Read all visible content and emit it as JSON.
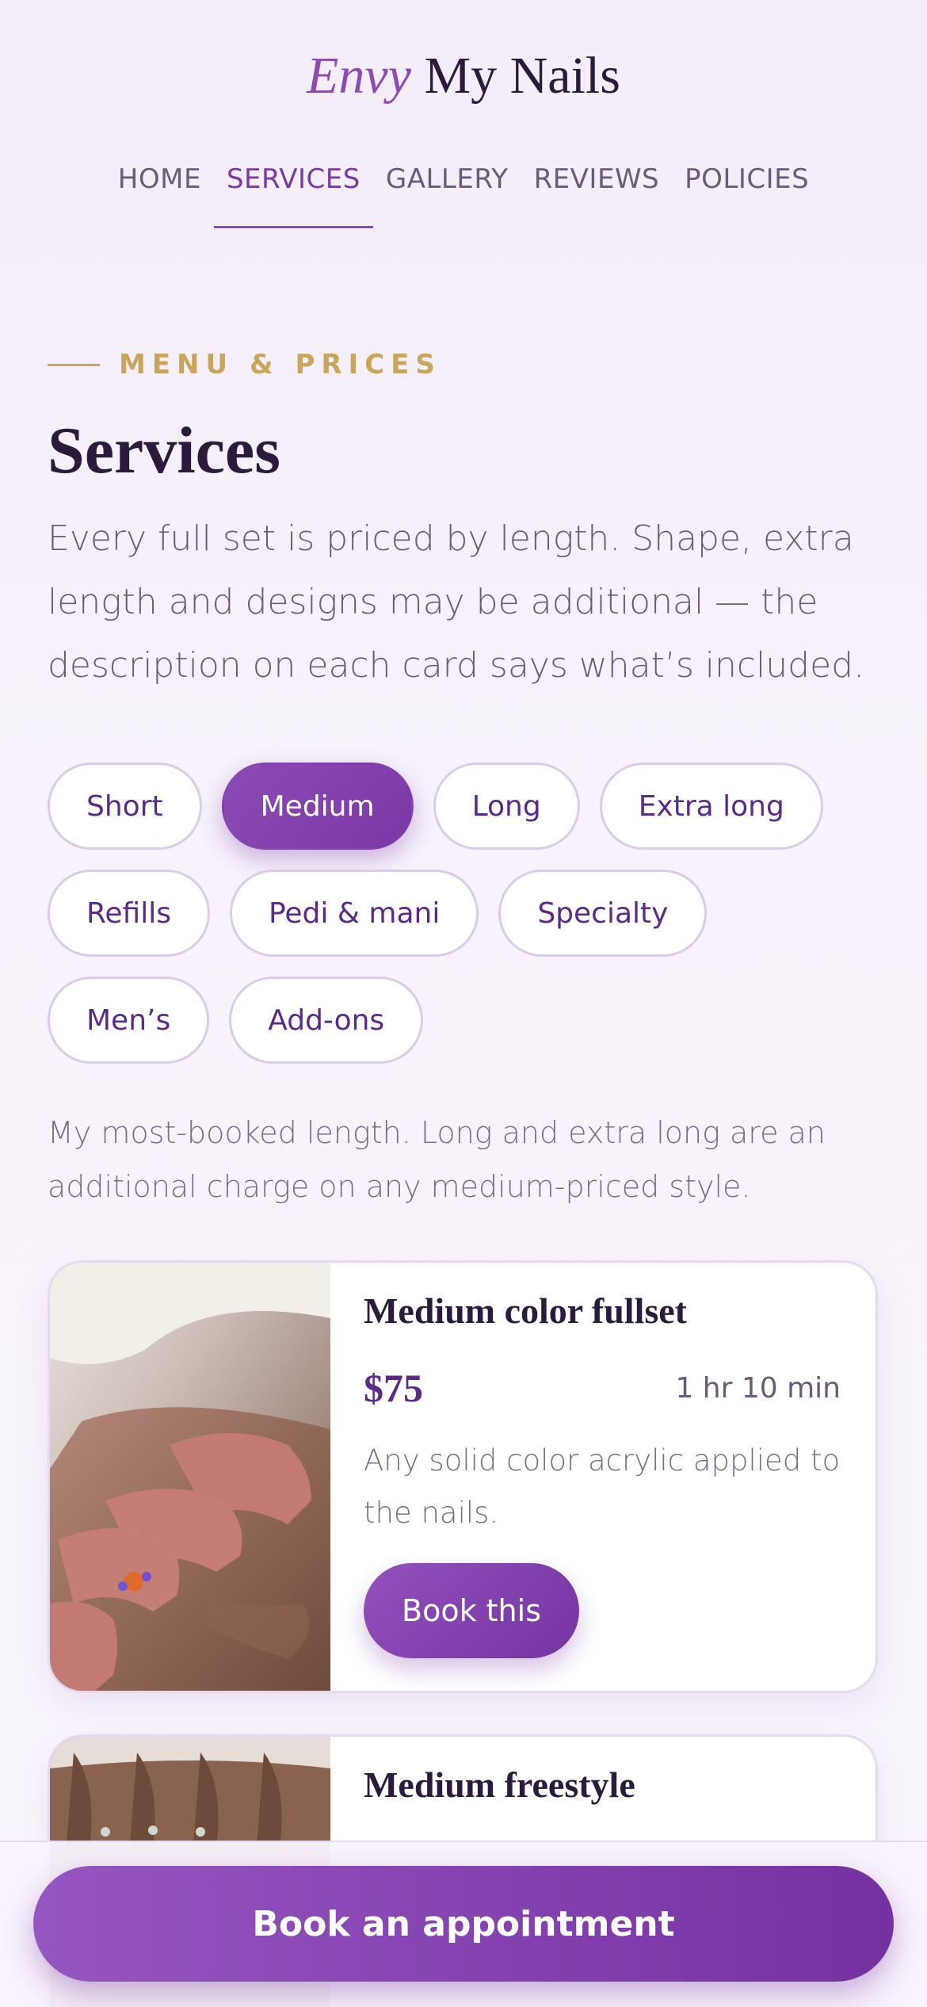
{
  "brand": {
    "accent": "Envy",
    "rest": "My Nails"
  },
  "nav": [
    {
      "label": "HOME"
    },
    {
      "label": "SERVICES"
    },
    {
      "label": "GALLERY"
    },
    {
      "label": "REVIEWS"
    },
    {
      "label": "POLICIES"
    }
  ],
  "nav_active": "SERVICES",
  "section": {
    "eyebrow": "MENU & PRICES",
    "title": "Services",
    "intro": "Every full set is priced by length. Shape, extra length and designs may be additional — the description on each card says what’s included."
  },
  "filters": [
    {
      "label": "Short"
    },
    {
      "label": "Medium"
    },
    {
      "label": "Long"
    },
    {
      "label": "Extra long"
    },
    {
      "label": "Refills"
    },
    {
      "label": "Pedi & mani"
    },
    {
      "label": "Specialty"
    },
    {
      "label": "Men’s"
    },
    {
      "label": "Add-ons"
    }
  ],
  "filter_active": "Medium",
  "category_note": "My most-booked length. Long and extra long are an additional charge on any medium-priced style.",
  "services": [
    {
      "title": "Medium color fullset",
      "price": "$75",
      "duration": "1 hr 10 min",
      "description": "Any solid color acrylic applied to the nails.",
      "button": "Book this"
    },
    {
      "title": "Medium freestyle"
    }
  ],
  "cta": {
    "label": "Book an appointment"
  },
  "colors": {
    "accent": "#8c4bb3",
    "gold": "#c9a55c",
    "ink": "#2a1b3d"
  }
}
